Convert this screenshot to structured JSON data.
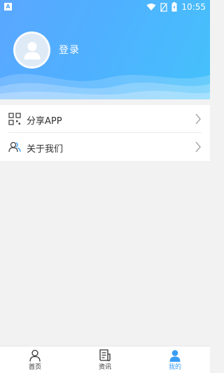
{
  "status_bar": {
    "time": "10:55",
    "left_icon_text": "A"
  },
  "profile": {
    "login_label": "登录"
  },
  "menu": {
    "items": [
      {
        "label": "分享APP",
        "icon": "qr-share-icon"
      },
      {
        "label": "关于我们",
        "icon": "users-icon"
      }
    ]
  },
  "tabbar": {
    "tabs": [
      {
        "label": "首页",
        "icon": "person-outline-icon",
        "active": false
      },
      {
        "label": "资讯",
        "icon": "news-icon",
        "active": false
      },
      {
        "label": "我的",
        "icon": "person-filled-icon",
        "active": true
      }
    ]
  },
  "colors": {
    "accent": "#3a9df5",
    "header_start": "#5aa7ff",
    "header_end": "#45c2fb"
  }
}
